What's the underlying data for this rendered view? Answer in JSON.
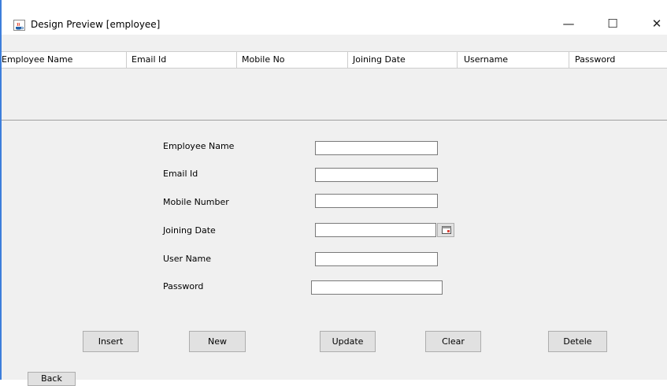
{
  "window": {
    "title": "Design Preview [employee]",
    "minimize_glyph": "—",
    "maximize_glyph": "☐",
    "close_glyph": "✕",
    "icon": "java-cup-icon"
  },
  "table": {
    "columns": [
      "Employee Name",
      "Email Id",
      "Mobile No",
      "Joining Date",
      "Username",
      "Password"
    ],
    "rows": []
  },
  "form": {
    "employee_name_label": "Employee Name",
    "email_label": "Email Id",
    "mobile_label": "Mobile Number",
    "joining_date_label": "Joining Date",
    "username_label": "User Name",
    "password_label": "Password",
    "employee_name_value": "",
    "email_value": "",
    "mobile_value": "",
    "joining_date_value": "",
    "username_value": "",
    "password_value": "",
    "calendar_icon": "calendar-icon"
  },
  "buttons": {
    "insert": "Insert",
    "new": "New",
    "update": "Update",
    "clear": "Clear",
    "delete": "Detele",
    "back": "Back"
  },
  "colors": {
    "window_border": "#3d7edb",
    "panel_bg": "#f0f0f0",
    "button_bg": "#e1e1e1"
  }
}
